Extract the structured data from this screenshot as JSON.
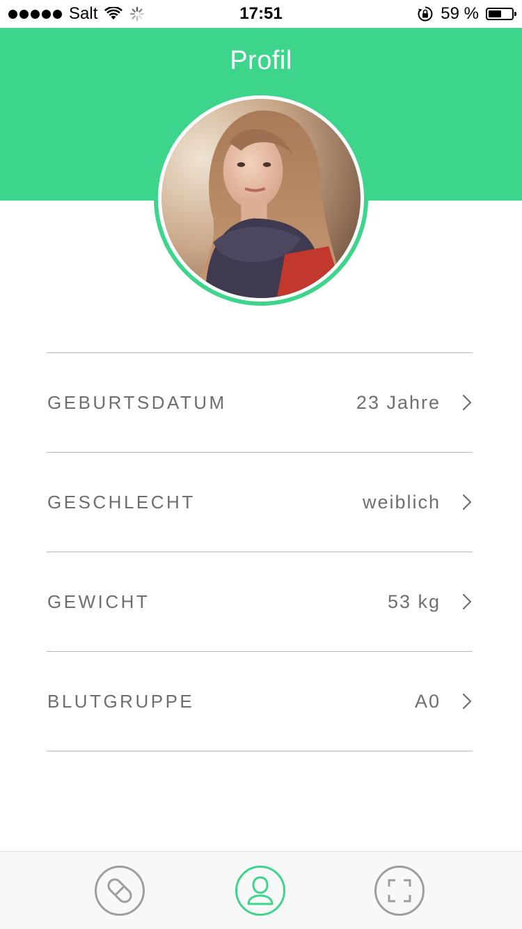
{
  "status_bar": {
    "carrier": "Salt",
    "time": "17:51",
    "battery_percent": "59 %",
    "battery_level": 0.59,
    "icons": [
      "signal-dots-icon",
      "wifi-icon",
      "activity-spinner-icon",
      "rotation-lock-icon",
      "battery-icon"
    ]
  },
  "header": {
    "title": "Profil",
    "background_color": "#3dd48c"
  },
  "profile": {
    "avatar": "profile-photo",
    "accent_color": "#3dd48c",
    "rows": [
      {
        "label": "GEBURTSDATUM",
        "value": "23 Jahre",
        "icon": "chevron-right-icon"
      },
      {
        "label": "GESCHLECHT",
        "value": "weiblich",
        "icon": "chevron-right-icon"
      },
      {
        "label": "GEWICHT",
        "value": "53 kg",
        "icon": "chevron-right-icon"
      },
      {
        "label": "BLUTGRUPPE",
        "value": "A0",
        "icon": "chevron-right-icon"
      }
    ]
  },
  "tab_bar": {
    "tabs": [
      {
        "name": "pills",
        "icon": "pill-icon",
        "active": false
      },
      {
        "name": "profile",
        "icon": "user-icon",
        "active": true
      },
      {
        "name": "scan",
        "icon": "scan-frame-icon",
        "active": false
      }
    ],
    "active_color": "#3dd48c",
    "inactive_color": "#9e9e9e"
  }
}
